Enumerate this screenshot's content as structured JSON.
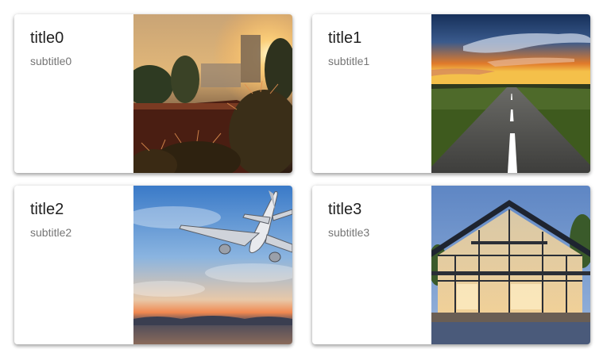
{
  "cards": [
    {
      "title": "title0",
      "subtitle": "subtitle0",
      "image": "sunset-cactus-photo"
    },
    {
      "title": "title1",
      "subtitle": "subtitle1",
      "image": "road-sunset-photo"
    },
    {
      "title": "title2",
      "subtitle": "subtitle2",
      "image": "airplane-sky-photo"
    },
    {
      "title": "title3",
      "subtitle": "subtitle3",
      "image": "modern-house-photo"
    }
  ]
}
